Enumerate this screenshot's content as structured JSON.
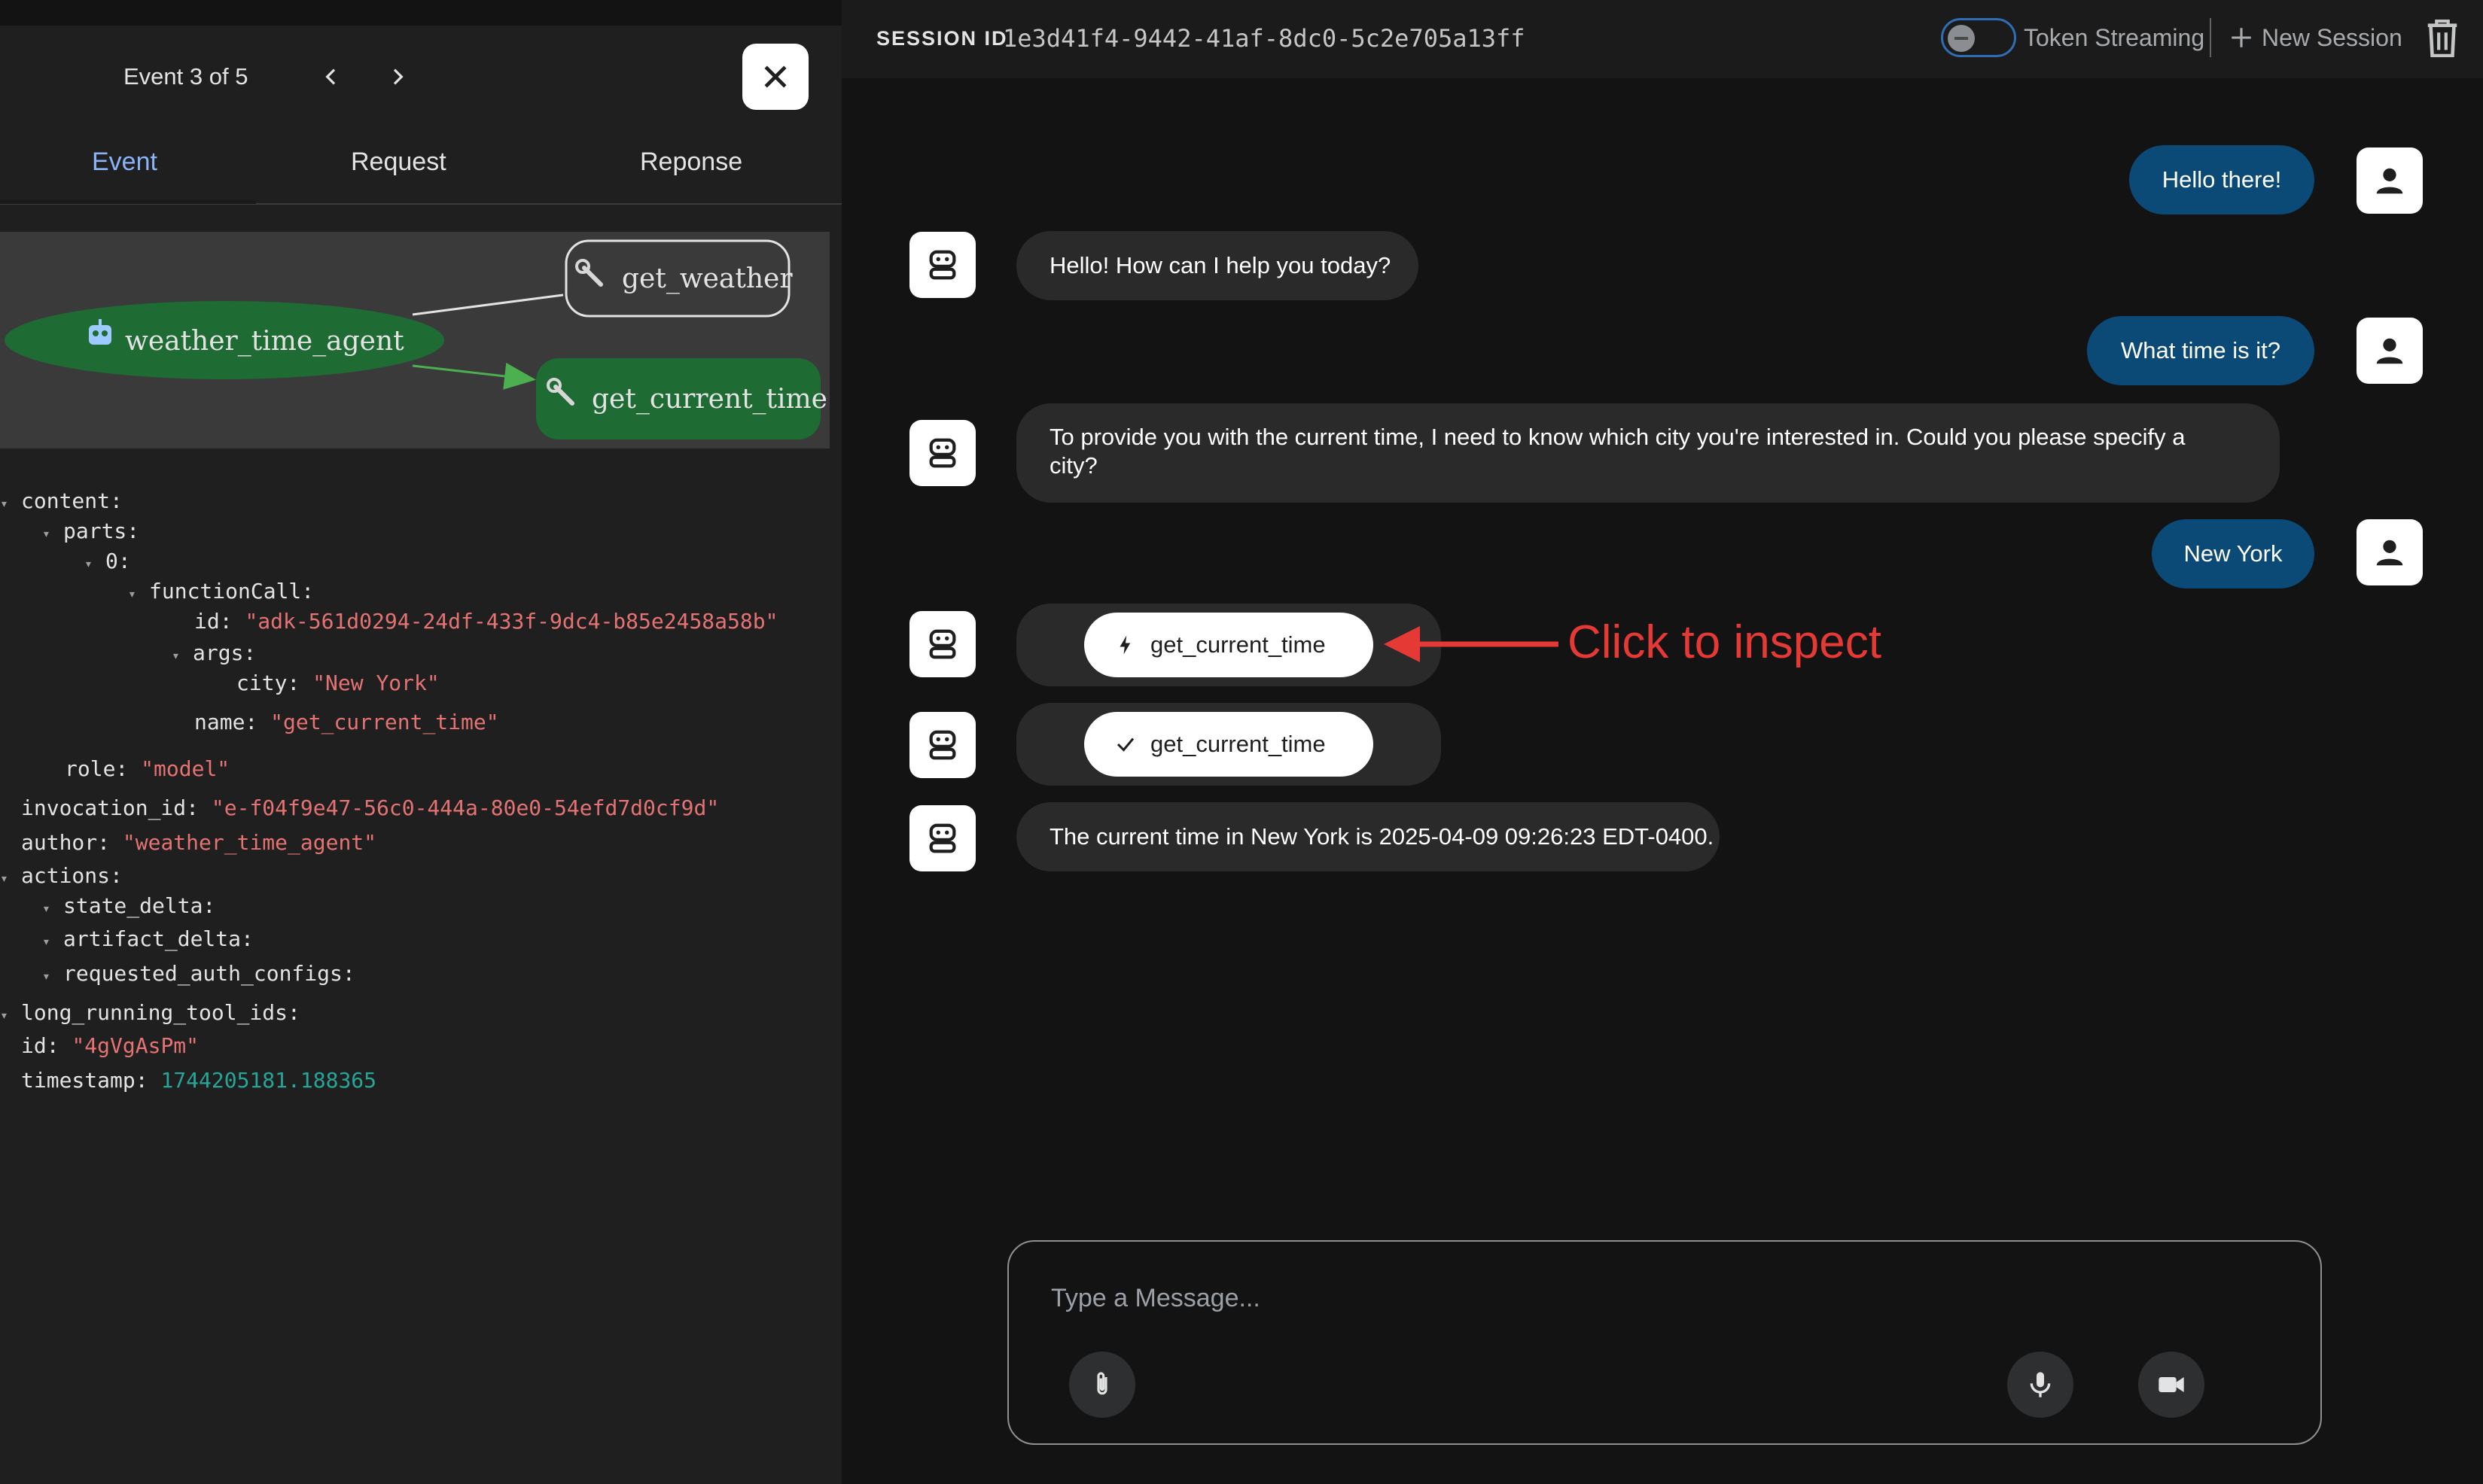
{
  "event_panel": {
    "event_counter": "Event 3 of 5",
    "tabs": [
      "Event",
      "Request",
      "Reponse"
    ],
    "graph": {
      "nodes": [
        "get_weather",
        "weather_time_agent",
        "get_current_time"
      ]
    },
    "tree": {
      "content": "content:",
      "parts": "parts:",
      "zero": "0:",
      "functionCall": "functionCall:",
      "id_key": "id:",
      "id_val": "\"adk-561d0294-24df-433f-9dc4-b85e2458a58b\"",
      "args": "args:",
      "city_key": "city:",
      "city_val": "\"New York\"",
      "name_key": "name:",
      "name_val": "\"get_current_time\"",
      "role_key": "role:",
      "role_val": "\"model\"",
      "invocation_key": "invocation_id:",
      "invocation_val": "\"e-f04f9e47-56c0-444a-80e0-54efd7d0cf9d\"",
      "author_key": "author:",
      "author_val": "\"weather_time_agent\"",
      "actions": "actions:",
      "state_delta": "state_delta:",
      "artifact_delta": "artifact_delta:",
      "requested_auth_configs": "requested_auth_configs:",
      "long_running": "long_running_tool_ids:",
      "eid_key": "id:",
      "eid_val": "\"4gVgAsPm\"",
      "ts_key": "timestamp:",
      "ts_val": "1744205181.188365"
    }
  },
  "header": {
    "session_label": "SESSION ID",
    "session_id": "1e3d41f4-9442-41af-8dc0-5c2e705a13ff",
    "token_streaming": "Token Streaming",
    "new_session": "New Session"
  },
  "chat": {
    "messages": [
      {
        "role": "user",
        "text": "Hello there!"
      },
      {
        "role": "bot",
        "text": "Hello! How can I help you today?"
      },
      {
        "role": "user",
        "text": "What time is it?"
      },
      {
        "role": "bot",
        "text": "To provide you with the current time, I need to know which city you're interested in. Could you please specify a city?"
      },
      {
        "role": "user",
        "text": "New York"
      },
      {
        "role": "bot",
        "type": "function_call",
        "text": "get_current_time"
      },
      {
        "role": "bot",
        "type": "function_response",
        "text": "get_current_time"
      },
      {
        "role": "bot",
        "text": "The current time in New York is 2025-04-09 09:26:23 EDT-0400."
      }
    ]
  },
  "annotation": {
    "text": "Click to inspect",
    "color": "#e53935"
  },
  "composer": {
    "placeholder": "Type a Message..."
  },
  "colors": {
    "user_bubble": "#0b4a77",
    "bot_bubble": "#2a2a2b",
    "graph_node_active": "#1e6b34",
    "active_tab": "#8ab4f8"
  }
}
